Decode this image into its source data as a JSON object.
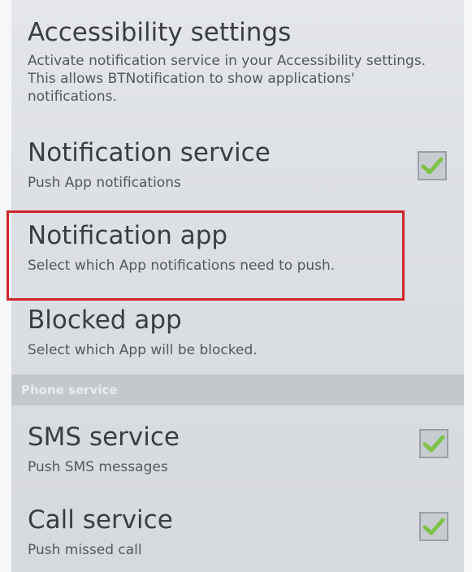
{
  "accessibility": {
    "title": "Accessibility settings",
    "summary": "Activate notification service in your Accessibility settings. This allows BTNotification to show applications' notifications."
  },
  "notification_service": {
    "title": "Notification service",
    "summary": "Push App notifications",
    "checked": true
  },
  "notification_app": {
    "title": "Notification app",
    "summary": "Select which App notifications need to push."
  },
  "blocked_app": {
    "title": "Blocked app",
    "summary": "Select which App will be blocked."
  },
  "phone_category": {
    "label": "Phone service"
  },
  "sms_service": {
    "title": "SMS service",
    "summary": "Push SMS messages",
    "checked": true
  },
  "call_service": {
    "title": "Call service",
    "summary": "Push missed call",
    "checked": true
  },
  "colors": {
    "checkmark": "#7ec24a",
    "highlight": "#d0262c"
  },
  "icons": {
    "checkbox": "checkmark-icon"
  }
}
